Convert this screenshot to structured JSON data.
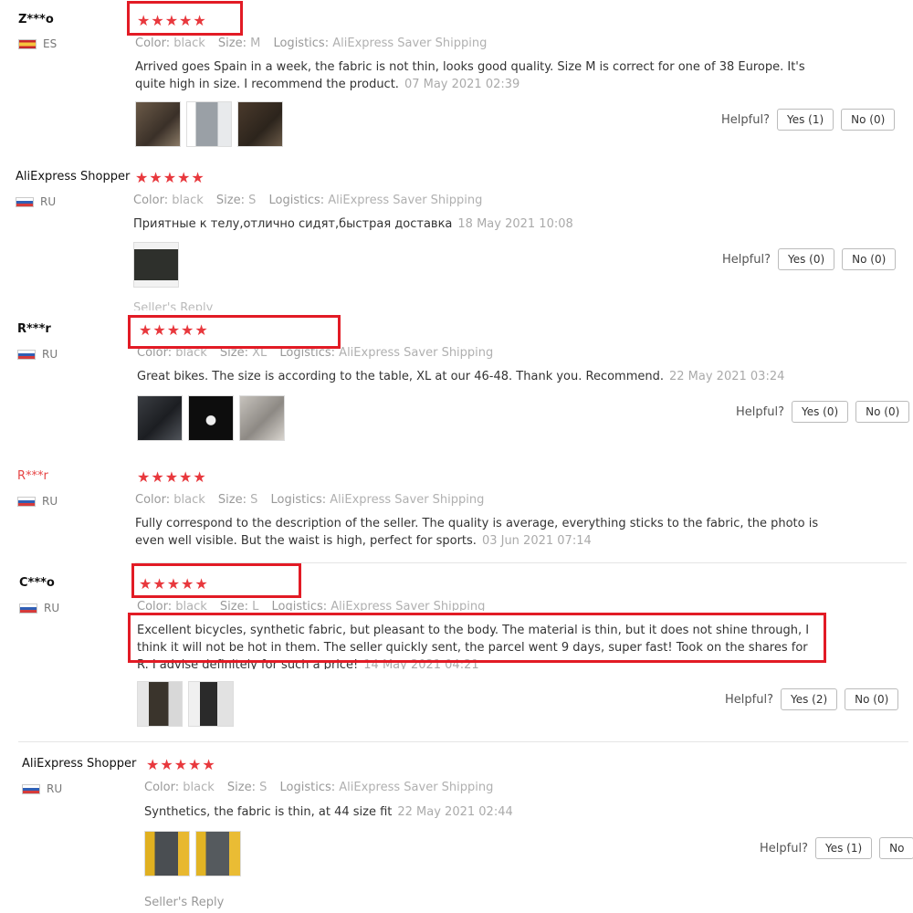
{
  "labels": {
    "color": "Color:",
    "size": "Size:",
    "logistics": "Logistics:",
    "helpful": "Helpful?"
  },
  "reviews": [
    {
      "user": "Z***o",
      "country": "ES",
      "stars": "★★★★★",
      "color": "black",
      "size": "M",
      "logistics": "AliExpress Saver Shipping",
      "text": "Arrived goes Spain in a week, the fabric is not thin, looks good quality. Size M is correct for one of 38 Europe. It's quite high in size. I recommend the product.",
      "date": "07 May 2021 02:39",
      "yes": "Yes (1)",
      "no": "No (0)"
    },
    {
      "user": "AliExpress Shopper",
      "country": "RU",
      "stars": "★★★★★",
      "color": "black",
      "size": "S",
      "logistics": "AliExpress Saver Shipping",
      "text": "Приятные к телу,отлично сидят,быстрая доставка",
      "date": "18 May 2021 10:08",
      "yes": "Yes (0)",
      "no": "No (0)",
      "reply": "Seller's Reply"
    },
    {
      "user": "R***r",
      "country": "RU",
      "stars": "★★★★★",
      "color": "black",
      "size": "XL",
      "logistics": "AliExpress Saver Shipping",
      "text": "Great bikes. The size is according to the table, XL at our 46-48. Thank you. Recommend.",
      "date": "22 May 2021 03:24",
      "yes": "Yes (0)",
      "no": "No (0)"
    },
    {
      "user": "R***r",
      "country": "RU",
      "stars": "★★★★★",
      "color": "black",
      "size": "S",
      "logistics": "AliExpress Saver Shipping",
      "text": "Fully correspond to the description of the seller. The quality is average, everything sticks to the fabric, the photo is even well visible. But the waist is high, perfect for sports.",
      "date": "03 Jun 2021 07:14"
    },
    {
      "user": "C***o",
      "country": "RU",
      "stars": "★★★★★",
      "color": "black",
      "size": "L",
      "logistics": "AliExpress Saver Shipping",
      "text": "Excellent bicycles, synthetic fabric, but pleasant to the body. The material is thin, but it does not shine through, I think it will not be hot in them. The seller quickly sent, the parcel went 9 days, super fast! Took on the shares for    R. I advise definitely for such a price!",
      "date": "14 May 2021 04:21",
      "yes": "Yes (2)",
      "no": "No (0)"
    },
    {
      "user": "AliExpress Shopper",
      "country": "RU",
      "stars": "★★★★★",
      "color": "black",
      "size": "S",
      "logistics": "AliExpress Saver Shipping",
      "text": "Synthetics, the fabric is thin, at 44 size fit",
      "date": "22 May 2021 02:44",
      "yes": "Yes (1)",
      "no": "No",
      "reply": "Seller's Reply"
    }
  ]
}
